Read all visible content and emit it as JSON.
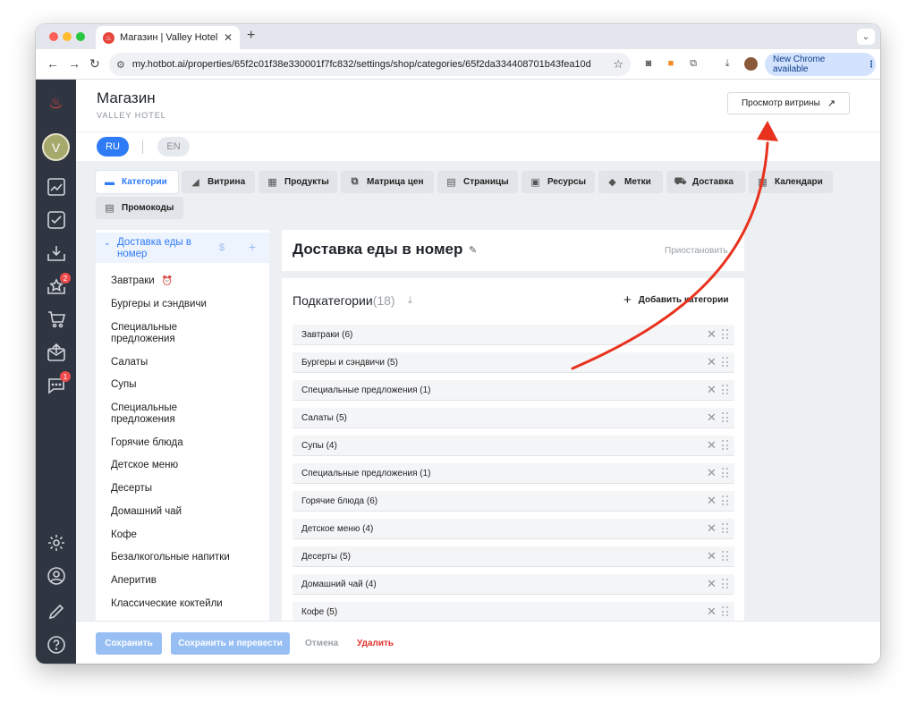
{
  "browser": {
    "tab_title": "Магазин | Valley Hotel | Hotbot",
    "tab_favicon": "hotbot-flame-icon",
    "url": "my.hotbot.ai/properties/65f2c01f38e330001f7fc832/settings/shop/categories/65f2da334408701b43fea10d",
    "update_pill": "New Chrome available",
    "accent_color": "#d3e3fd"
  },
  "sidebar": {
    "avatar_initial": "V",
    "badges": {
      "ratings": "2",
      "messages": "1"
    }
  },
  "header": {
    "title": "Магазин",
    "subtitle": "VALLEY HOTEL",
    "preview_button": "Просмотр витрины",
    "preview_arrow": "↗"
  },
  "languages": {
    "ru": "RU",
    "en": "EN"
  },
  "section_tabs": [
    {
      "label": "Категории",
      "icon": "store-icon"
    },
    {
      "label": "Витрина",
      "icon": "showcase-icon"
    },
    {
      "label": "Продукты",
      "icon": "products-icon"
    },
    {
      "label": "Матрица цен",
      "icon": "price-matrix-icon"
    },
    {
      "label": "Страницы",
      "icon": "pages-icon"
    },
    {
      "label": "Ресурсы",
      "icon": "resources-icon"
    },
    {
      "label": "Метки",
      "icon": "tag-icon"
    },
    {
      "label": "Доставка",
      "icon": "truck-icon"
    },
    {
      "label": "Календари",
      "icon": "calendar-icon"
    },
    {
      "label": "Промокоды",
      "icon": "promo-icon"
    }
  ],
  "category_tree": {
    "root": "Доставка еды в номер",
    "children": [
      "Завтраки",
      "Бургеры и сэндвичи",
      "Специальные предложения",
      "Салаты",
      "Супы",
      "Специальные предложения",
      "Горячие блюда",
      "Детское меню",
      "Десерты",
      "Домашний чай",
      "Кофе",
      "Безалкогольные напитки",
      "Аперитив",
      "Классические коктейли"
    ]
  },
  "category": {
    "title": "Доставка еды в номер",
    "pause_link": "Приостановить",
    "subcategories_label": "Подкатегории",
    "subcategories_count": "(18)",
    "add_button": "Добавить категории",
    "rows": [
      "Завтраки (6)",
      "Бургеры и сэндвичи (5)",
      "Специальные предложения (1)",
      "Салаты (5)",
      "Супы (4)",
      "Специальные предложения (1)",
      "Горячие блюда (6)",
      "Детское меню (4)",
      "Десерты (5)",
      "Домашний чай (4)",
      "Кофе (5)"
    ]
  },
  "footer": {
    "save": "Сохранить",
    "save_translate": "Сохранить и перевести",
    "cancel": "Отмена",
    "delete": "Удалить",
    "delete_color": "#e0332b"
  },
  "annotation": {
    "arrow_color": "#e8321e"
  }
}
